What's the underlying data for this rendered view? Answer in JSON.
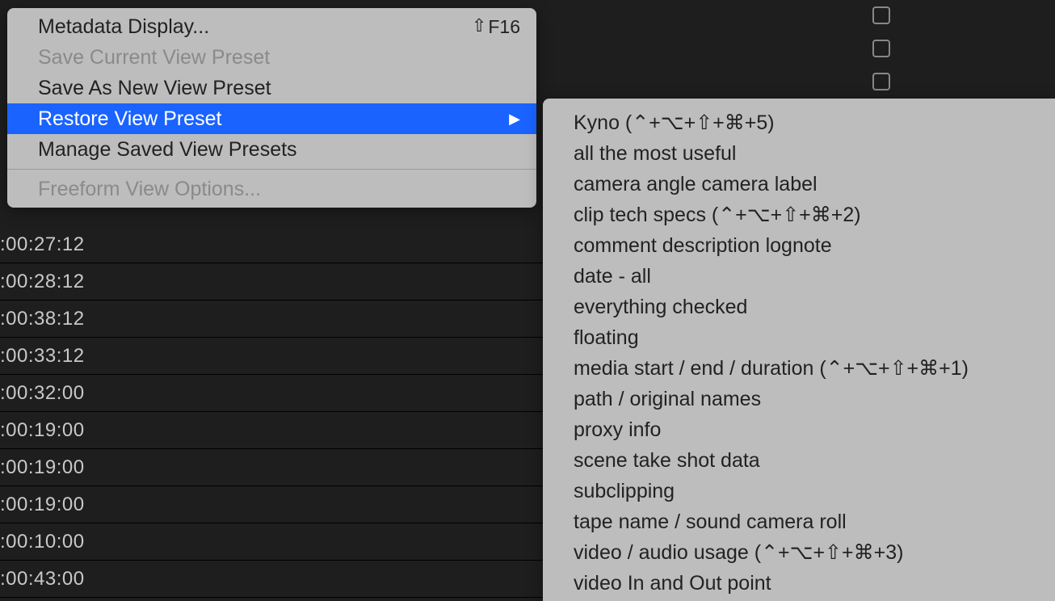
{
  "primaryMenu": {
    "metadataDisplay": {
      "label": "Metadata Display...",
      "shortcut": "F16"
    },
    "saveCurrent": {
      "label": "Save Current View Preset"
    },
    "saveAsNew": {
      "label": "Save As New View Preset"
    },
    "restore": {
      "label": "Restore View Preset"
    },
    "manage": {
      "label": "Manage Saved View Presets"
    },
    "freeform": {
      "label": "Freeform View Options..."
    }
  },
  "submenu": {
    "items": [
      "Kyno (⌃+⌥+⇧+⌘+5)",
      "all the most useful",
      "camera angle camera label",
      "clip tech specs (⌃+⌥+⇧+⌘+2)",
      "comment description lognote",
      "date - all",
      "everything checked",
      "floating",
      "media start / end / duration (⌃+⌥+⇧+⌘+1)",
      "path / original names",
      "proxy info",
      "scene take shot data",
      "subclipping",
      "tape name / sound camera roll",
      "video / audio usage (⌃+⌥+⇧+⌘+3)",
      "video In and Out point"
    ]
  },
  "timecodes": [
    ":00:27:12",
    ":00:28:12",
    ":00:38:12",
    ":00:33:12",
    ":00:32:00",
    ":00:19:00",
    ":00:19:00",
    ":00:19:00",
    ":00:10:00",
    ":00:43:00"
  ]
}
